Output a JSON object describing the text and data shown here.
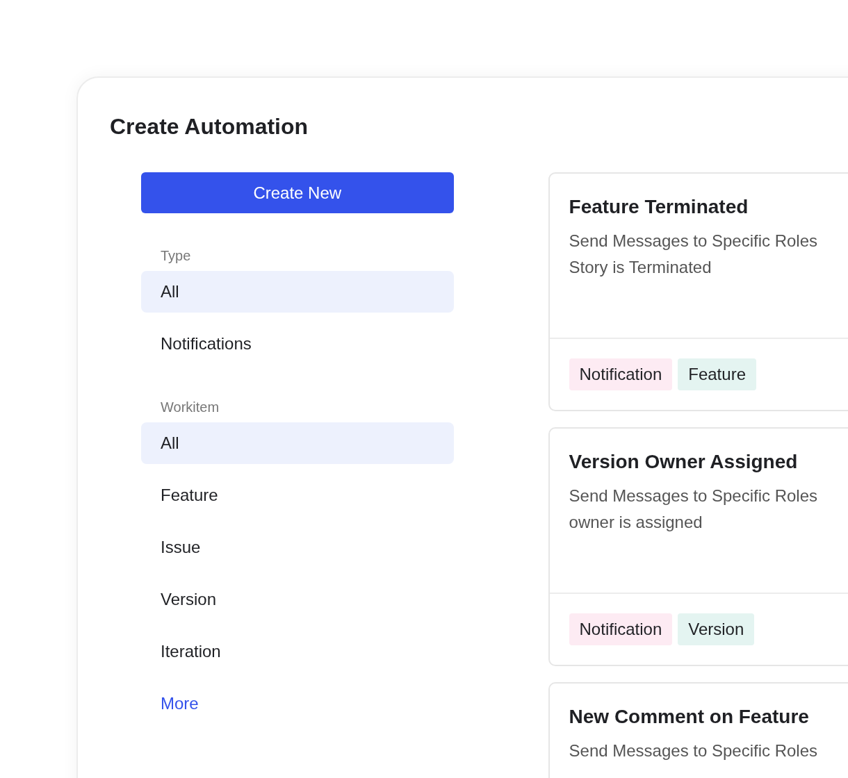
{
  "title": "Create Automation",
  "create_button": "Create New",
  "filter_groups": [
    {
      "label": "Type",
      "items": [
        {
          "label": "All",
          "selected": true
        },
        {
          "label": "Notifications",
          "selected": false
        }
      ]
    },
    {
      "label": "Workitem",
      "items": [
        {
          "label": "All",
          "selected": true
        },
        {
          "label": "Feature",
          "selected": false
        },
        {
          "label": "Issue",
          "selected": false
        },
        {
          "label": "Version",
          "selected": false
        },
        {
          "label": "Iteration",
          "selected": false
        }
      ]
    }
  ],
  "more_link": "More",
  "cards": [
    {
      "title": "Feature Terminated",
      "description_lines": [
        "Send Messages to Specific Roles",
        "Story is Terminated"
      ],
      "tags": [
        {
          "label": "Notification",
          "color": "#fdebf3"
        },
        {
          "label": "Feature",
          "color": "#e4f4f1"
        }
      ]
    },
    {
      "title": "Version Owner Assigned",
      "description_lines": [
        "Send Messages to Specific Roles",
        "owner is assigned"
      ],
      "tags": [
        {
          "label": "Notification",
          "color": "#fdebf3"
        },
        {
          "label": "Version",
          "color": "#e4f4f1"
        }
      ]
    },
    {
      "title": "New Comment on Feature",
      "description_lines": [
        "Send Messages to Specific Roles"
      ]
    }
  ]
}
